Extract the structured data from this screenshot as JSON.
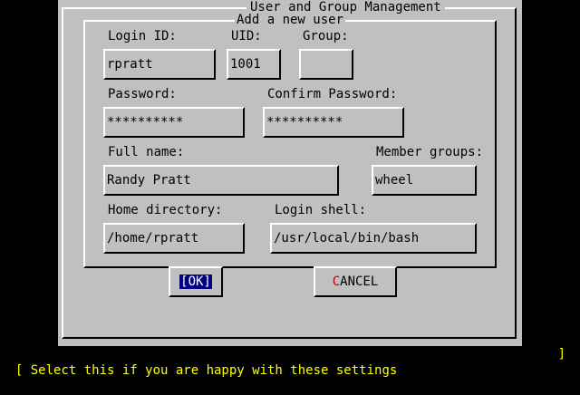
{
  "window": {
    "title": "User and Group Management"
  },
  "form": {
    "group_title": "Add a new user",
    "login_id": {
      "label": "Login ID:",
      "value": "rpratt"
    },
    "uid": {
      "label": "UID:",
      "value": "1001"
    },
    "group": {
      "label": "Group:",
      "value": ""
    },
    "password": {
      "label": "Password:",
      "value": "**********"
    },
    "confirm_password": {
      "label": "Confirm Password:",
      "value": "**********"
    },
    "full_name": {
      "label": "Full name:",
      "value": "Randy Pratt"
    },
    "member_groups": {
      "label": "Member groups:",
      "value": "wheel"
    },
    "home_directory": {
      "label": "Home directory:",
      "value": "/home/rpratt"
    },
    "login_shell": {
      "label": "Login shell:",
      "value": "/usr/local/bin/bash"
    }
  },
  "buttons": {
    "ok": "[OK]",
    "cancel_hotkey": "C",
    "cancel_rest": "ANCEL"
  },
  "status": {
    "left": "[ Select this if you are happy with these settings",
    "right": "]"
  },
  "colors": {
    "dialog_bg": "#c0c0c0",
    "screen_bg": "#000000",
    "status_text": "#ffff00",
    "selected_button_bg": "#000080",
    "hotkey": "#c00000"
  }
}
